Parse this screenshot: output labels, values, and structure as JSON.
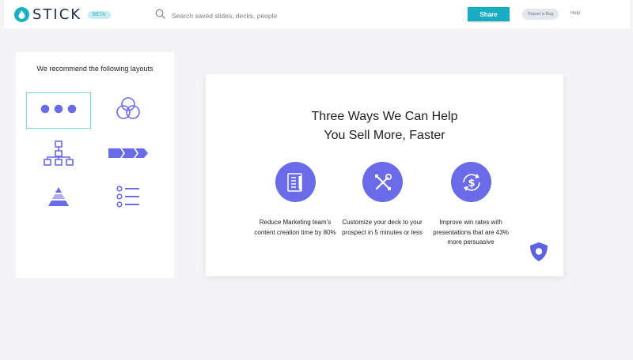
{
  "header": {
    "logo_text": "STICK",
    "beta_label": "BETA",
    "search_placeholder": "Search saved slides, decks, people",
    "share_label": "Share",
    "report_bug_label": "Report a Bug",
    "help_label": "Help"
  },
  "layouts": {
    "title": "We recommend the following layouts",
    "items": [
      {
        "icon": "three-dots-icon",
        "selected": true
      },
      {
        "icon": "venn-circles-icon",
        "selected": false
      },
      {
        "icon": "org-chart-icon",
        "selected": false
      },
      {
        "icon": "process-arrows-icon",
        "selected": false
      },
      {
        "icon": "pyramid-icon",
        "selected": false
      },
      {
        "icon": "bullet-list-icon",
        "selected": false
      }
    ]
  },
  "slide": {
    "title_line1": "Three Ways We Can Help",
    "title_line2": "You Sell More, Faster",
    "features": [
      {
        "icon": "document-pencil-icon",
        "text": "Reduce Marketing team’s content creation time by 80%"
      },
      {
        "icon": "tools-icon",
        "text": "Customize your deck to your prospect in 5 minutes or less"
      },
      {
        "icon": "dollar-refresh-icon",
        "text": "Improve win rates with presentations  that are 43% more persuasive"
      }
    ]
  },
  "colors": {
    "accent_teal": "#18adc2",
    "icon_purple": "#6a6be8",
    "selected_border": "#7fd8d0"
  }
}
